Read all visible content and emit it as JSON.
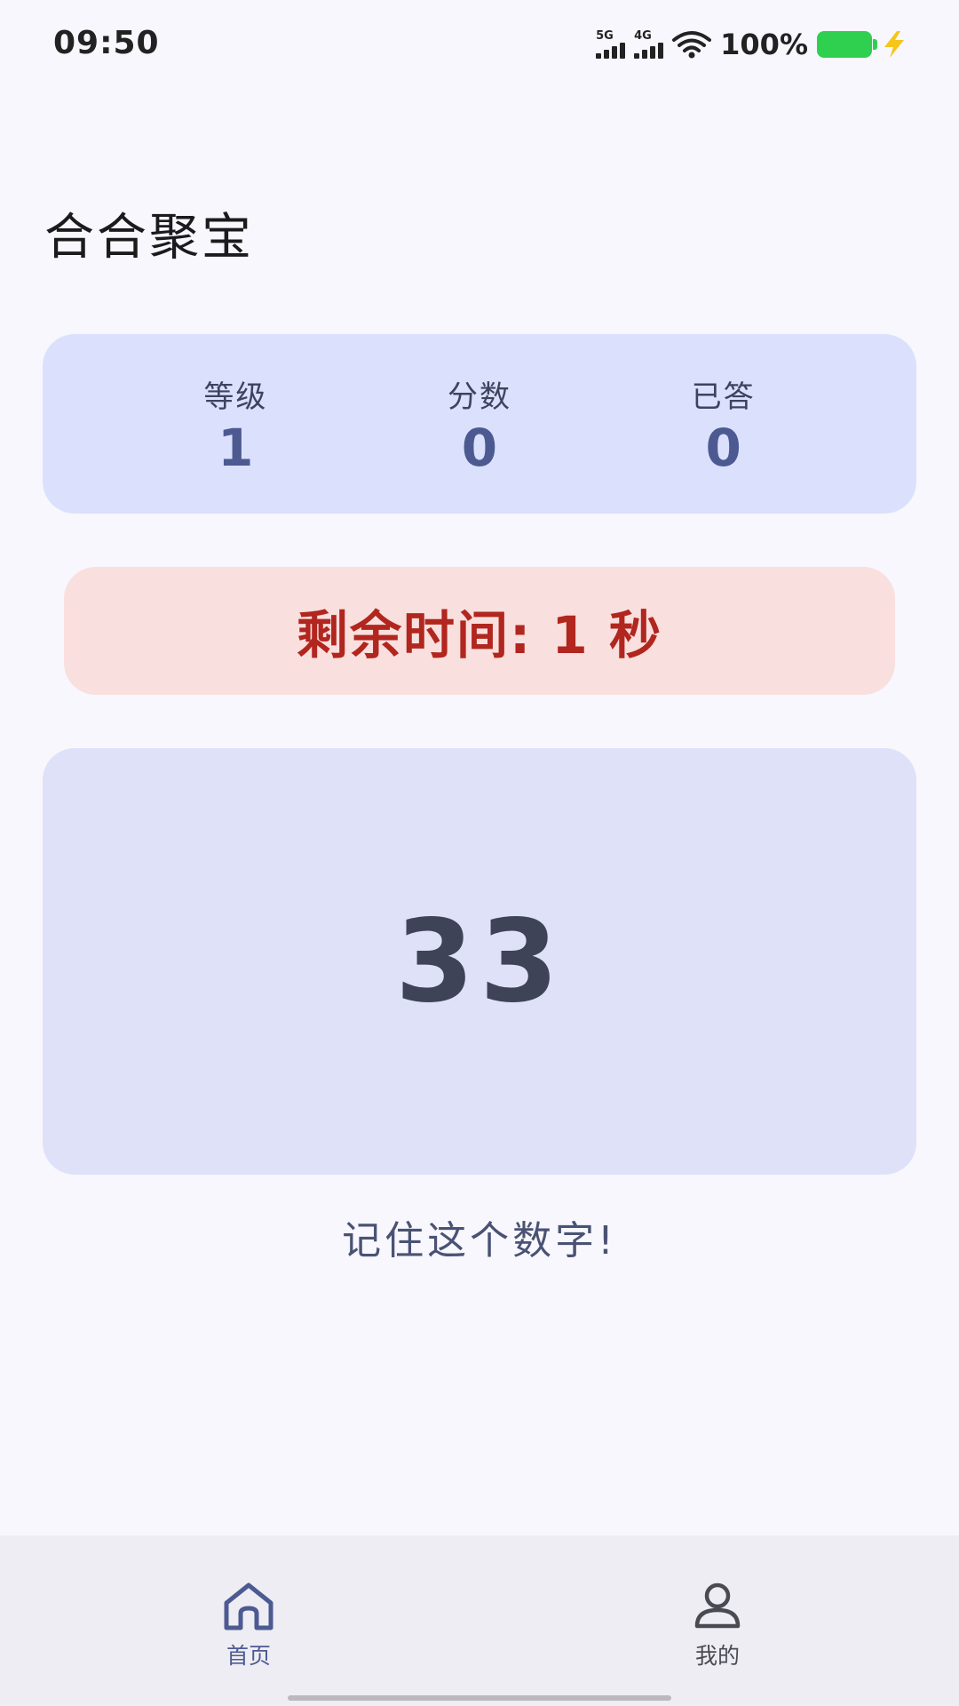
{
  "status_bar": {
    "time": "09:50",
    "signal1_label": "5G",
    "signal2_label": "4G",
    "battery_percent": "100%",
    "battery_color": "#2fd04f",
    "charging_icon": "bolt-icon"
  },
  "app": {
    "title": "合合聚宝"
  },
  "stats": [
    {
      "label": "等级",
      "value": "1"
    },
    {
      "label": "分数",
      "value": "0"
    },
    {
      "label": "已答",
      "value": "0"
    }
  ],
  "timer": {
    "text": "剩余时间: 1 秒"
  },
  "memory": {
    "number": "33",
    "hint": "记住这个数字!"
  },
  "bottom_nav": [
    {
      "label": "首页",
      "icon": "home-icon",
      "active": true
    },
    {
      "label": "我的",
      "icon": "user-icon",
      "active": false
    }
  ],
  "colors": {
    "accent": "#4d5a92",
    "stats_bg": "#dbe1fc",
    "timer_bg": "#f9dfde",
    "timer_text": "#b1261e",
    "number_bg": "#dfe1f9"
  }
}
